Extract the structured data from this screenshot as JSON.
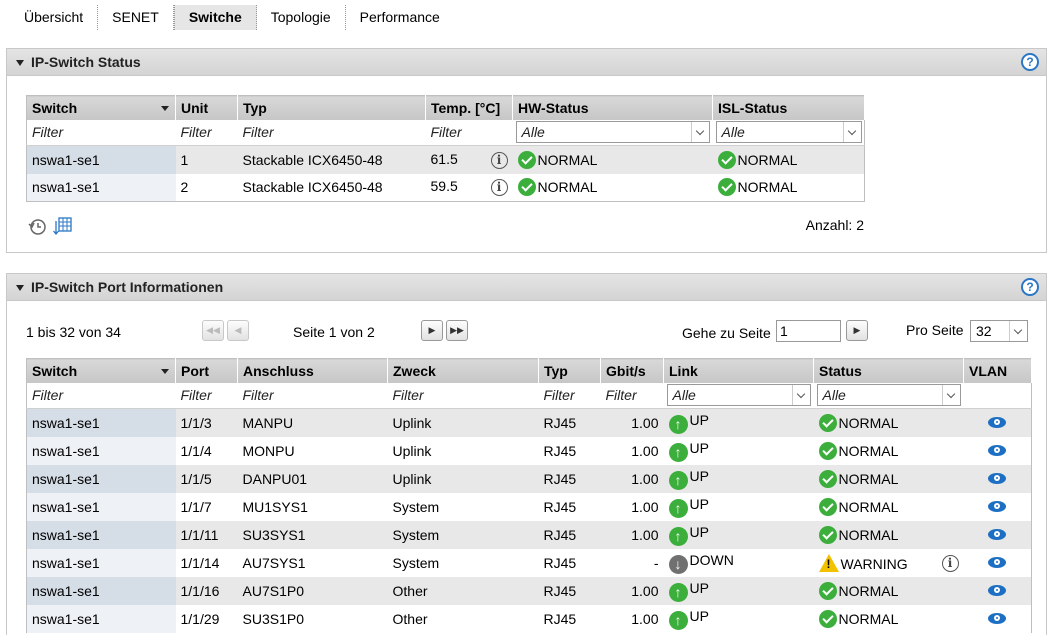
{
  "tabs": [
    "Übersicht",
    "SENET",
    "Switche",
    "Topologie",
    "Performance"
  ],
  "status_panel": {
    "title": "IP-Switch Status",
    "columns": [
      "Switch",
      "Unit",
      "Typ",
      "Temp. [°C]",
      "HW-Status",
      "ISL-Status"
    ],
    "filter_placeholder": "Filter",
    "select_all": "Alle",
    "rows": [
      {
        "switch": "nswa1-se1",
        "unit": "1",
        "typ": "Stackable ICX6450-48",
        "temp": "61.5",
        "hw": "NORMAL",
        "isl": "NORMAL"
      },
      {
        "switch": "nswa1-se1",
        "unit": "2",
        "typ": "Stackable ICX6450-48",
        "temp": "59.5",
        "hw": "NORMAL",
        "isl": "NORMAL"
      }
    ],
    "count_label": "Anzahl: 2"
  },
  "port_panel": {
    "title": "IP-Switch Port Informationen",
    "range_text": "1 bis 32 von 34",
    "page_text": "Seite 1 von 2",
    "goto_label": "Gehe zu Seite",
    "goto_value": "1",
    "per_page_label": "Pro Seite",
    "per_page_value": "32",
    "columns": [
      "Switch",
      "Port",
      "Anschluss",
      "Zweck",
      "Typ",
      "Gbit/s",
      "Link",
      "Status",
      "VLAN"
    ],
    "filter_placeholder": "Filter",
    "select_all": "Alle",
    "rows": [
      {
        "switch": "nswa1-se1",
        "port": "1/1/3",
        "anschluss": "MANPU",
        "zweck": "Uplink",
        "typ": "RJ45",
        "gbit": "1.00",
        "link": "UP",
        "status": "NORMAL"
      },
      {
        "switch": "nswa1-se1",
        "port": "1/1/4",
        "anschluss": "MONPU",
        "zweck": "Uplink",
        "typ": "RJ45",
        "gbit": "1.00",
        "link": "UP",
        "status": "NORMAL"
      },
      {
        "switch": "nswa1-se1",
        "port": "1/1/5",
        "anschluss": "DANPU01",
        "zweck": "Uplink",
        "typ": "RJ45",
        "gbit": "1.00",
        "link": "UP",
        "status": "NORMAL"
      },
      {
        "switch": "nswa1-se1",
        "port": "1/1/7",
        "anschluss": "MU1SYS1",
        "zweck": "System",
        "typ": "RJ45",
        "gbit": "1.00",
        "link": "UP",
        "status": "NORMAL"
      },
      {
        "switch": "nswa1-se1",
        "port": "1/1/11",
        "anschluss": "SU3SYS1",
        "zweck": "System",
        "typ": "RJ45",
        "gbit": "1.00",
        "link": "UP",
        "status": "NORMAL"
      },
      {
        "switch": "nswa1-se1",
        "port": "1/1/14",
        "anschluss": "AU7SYS1",
        "zweck": "System",
        "typ": "RJ45",
        "gbit": "-",
        "link": "DOWN",
        "status": "WARNING"
      },
      {
        "switch": "nswa1-se1",
        "port": "1/1/16",
        "anschluss": "AU7S1P0",
        "zweck": "Other",
        "typ": "RJ45",
        "gbit": "1.00",
        "link": "UP",
        "status": "NORMAL"
      },
      {
        "switch": "nswa1-se1",
        "port": "1/1/29",
        "anschluss": "SU3S1P0",
        "zweck": "Other",
        "typ": "RJ45",
        "gbit": "1.00",
        "link": "UP",
        "status": "NORMAL"
      }
    ]
  }
}
